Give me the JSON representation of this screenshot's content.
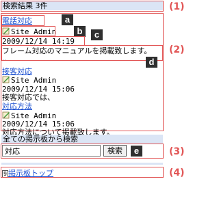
{
  "header": {
    "title": "検索結果 3件"
  },
  "results": [
    {
      "title": "電話対応",
      "author": "Site Admin",
      "date": "2009/12/14 14:19",
      "excerpt_line1": "フレーム対応のマニュアルを掲載致します。",
      "excerpt_line2": ".."
    },
    {
      "title": "接客対応",
      "author": "Site Admin",
      "date": "2009/12/14 15:06",
      "excerpt_line1": "接客対応では、"
    },
    {
      "title": "対応方法",
      "author": "Site Admin",
      "date": "2009/12/14 15:06",
      "excerpt_line1": "対応方法について掲載致します。"
    }
  ],
  "search": {
    "heading": "全ての掲示板から検索",
    "value": "対応",
    "button_label": "検索"
  },
  "footer": {
    "key": "9",
    "link_label": "掲示板トップ"
  },
  "annotations": {
    "sections": [
      "(1)",
      "(2)",
      "(3)",
      "(4)"
    ],
    "badges": [
      "a",
      "b",
      "c",
      "d",
      "e"
    ]
  },
  "colors": {
    "annotation_red": "#e25656",
    "link_blue": "#1a4fd1",
    "header_bg": "#dbe5f5"
  }
}
